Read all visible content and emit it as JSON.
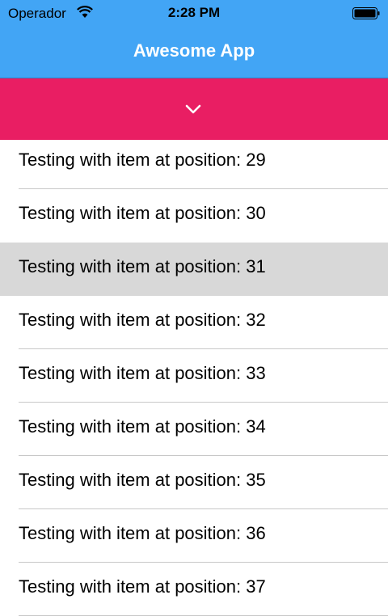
{
  "status_bar": {
    "carrier": "Operador",
    "time": "2:28 PM"
  },
  "nav": {
    "title": "Awesome App"
  },
  "colors": {
    "nav_background": "#42a5f5",
    "collapse_bar": "#e91e63",
    "selected_row": "#d8d8d8"
  },
  "list": {
    "items": [
      "Testing with item at position: 29",
      "Testing with item at position: 30",
      "Testing with item at position: 31",
      "Testing with item at position: 32",
      "Testing with item at position: 33",
      "Testing with item at position: 34",
      "Testing with item at position: 35",
      "Testing with item at position: 36",
      "Testing with item at position: 37"
    ],
    "selected_index": 2
  }
}
